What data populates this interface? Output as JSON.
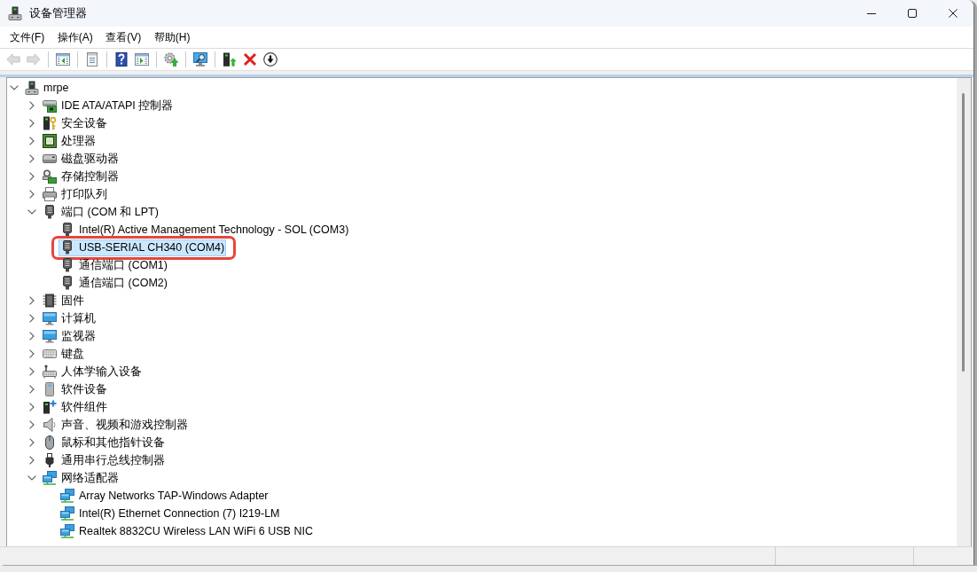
{
  "window": {
    "title": "设备管理器"
  },
  "menu": [
    "文件(F)",
    "操作(A)",
    "查看(V)",
    "帮助(H)"
  ],
  "toolbar": [
    [
      {
        "kind": "back",
        "disabled": true
      },
      {
        "kind": "forward",
        "disabled": true
      }
    ],
    [
      {
        "kind": "console-tree",
        "disabled": false
      }
    ],
    [
      {
        "kind": "properties",
        "disabled": false
      }
    ],
    [
      {
        "kind": "help",
        "disabled": false
      },
      {
        "kind": "action-pane",
        "disabled": false
      }
    ],
    [
      {
        "kind": "update-driver",
        "disabled": false
      }
    ],
    [
      {
        "kind": "scan-hardware",
        "disabled": false
      }
    ],
    [
      {
        "kind": "enable-device",
        "disabled": false
      },
      {
        "kind": "uninstall",
        "disabled": false
      },
      {
        "kind": "disable-device",
        "disabled": false
      }
    ]
  ],
  "tree": {
    "label": "mrpe",
    "kind": "pc",
    "expanded": true,
    "selected": false,
    "children": [
      {
        "label": "IDE ATA/ATAPI 控制器",
        "kind": "ide-controller",
        "expanded": false,
        "selected": false
      },
      {
        "label": "安全设备",
        "kind": "security-device",
        "expanded": false,
        "selected": false
      },
      {
        "label": "处理器",
        "kind": "processor",
        "expanded": false,
        "selected": false
      },
      {
        "label": "磁盘驱动器",
        "kind": "disk-drive",
        "expanded": false,
        "selected": false
      },
      {
        "label": "存储控制器",
        "kind": "storage-controller",
        "expanded": false,
        "selected": false
      },
      {
        "label": "打印队列",
        "kind": "print-queue",
        "expanded": false,
        "selected": false
      },
      {
        "label": "端口 (COM 和 LPT)",
        "kind": "port",
        "expanded": true,
        "selected": false,
        "children": [
          {
            "label": "Intel(R) Active Management Technology - SOL (COM3)",
            "kind": "port",
            "selected": false,
            "circled": false
          },
          {
            "label": "USB-SERIAL CH340 (COM4)",
            "kind": "port",
            "selected": true,
            "circled": true
          },
          {
            "label": "通信端口 (COM1)",
            "kind": "port",
            "selected": false,
            "circled": false
          },
          {
            "label": "通信端口 (COM2)",
            "kind": "port",
            "selected": false,
            "circled": false
          }
        ]
      },
      {
        "label": "固件",
        "kind": "firmware",
        "expanded": false,
        "selected": false
      },
      {
        "label": "计算机",
        "kind": "computer",
        "expanded": false,
        "selected": false
      },
      {
        "label": "监视器",
        "kind": "monitor",
        "expanded": false,
        "selected": false
      },
      {
        "label": "键盘",
        "kind": "keyboard",
        "expanded": false,
        "selected": false
      },
      {
        "label": "人体学输入设备",
        "kind": "hid",
        "expanded": false,
        "selected": false
      },
      {
        "label": "软件设备",
        "kind": "software-device",
        "expanded": false,
        "selected": false
      },
      {
        "label": "软件组件",
        "kind": "software-component",
        "expanded": false,
        "selected": false
      },
      {
        "label": "声音、视频和游戏控制器",
        "kind": "sound",
        "expanded": false,
        "selected": false
      },
      {
        "label": "鼠标和其他指针设备",
        "kind": "mouse",
        "expanded": false,
        "selected": false
      },
      {
        "label": "通用串行总线控制器",
        "kind": "usb-controller",
        "expanded": false,
        "selected": false
      },
      {
        "label": "网络适配器",
        "kind": "network-adapter",
        "expanded": true,
        "selected": false,
        "children": [
          {
            "label": "Array Networks TAP-Windows Adapter",
            "kind": "network-adapter",
            "selected": false,
            "circled": false
          },
          {
            "label": "Intel(R) Ethernet Connection (7) I219-LM",
            "kind": "network-adapter",
            "selected": false,
            "circled": false
          },
          {
            "label": "Realtek 8832CU Wireless LAN WiFi 6 USB NIC",
            "kind": "network-adapter",
            "selected": false,
            "circled": false
          }
        ]
      }
    ]
  }
}
